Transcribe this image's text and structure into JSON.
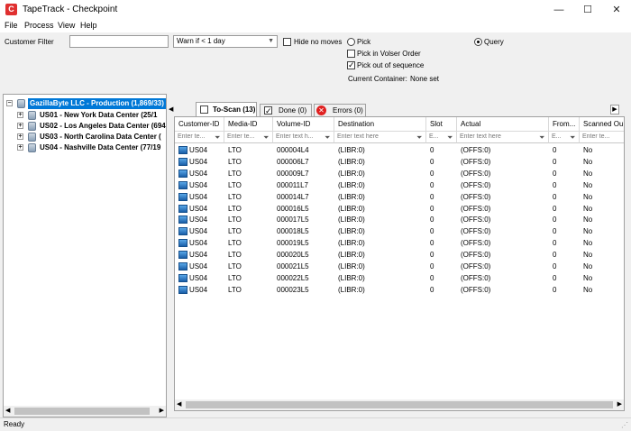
{
  "window": {
    "title": "TapeTrack - Checkpoint",
    "icon_letter": "C",
    "minimize": "—",
    "maximize": "☐",
    "close": "✕"
  },
  "menu": [
    "File",
    "Process",
    "View",
    "Help"
  ],
  "filter": {
    "customer_filter_label": "Customer Filter",
    "customer_filter_value": "",
    "warn_value": "Warn if < 1 day",
    "hide_no_moves": "Hide no moves",
    "pick": "Pick",
    "pick_volser_order": "Pick in Volser Order",
    "pick_out_of_sequence": "Pick out of sequence",
    "current_container_label": "Current Container:",
    "current_container_value": "None set",
    "query": "Query"
  },
  "tree": {
    "root": "GazillaByte LLC - Production (1,869/33)",
    "children": [
      "US01 - New York Data Center (25/1",
      "US02 - Los Angeles Data Center (694",
      "US03 - North Carolina Data Center (",
      "US04 - Nashville Data Center (77/19"
    ]
  },
  "tabs": [
    {
      "label": "To-Scan (13)",
      "icon": "checkbox-empty-icon"
    },
    {
      "label": "Done (0)",
      "icon": "checkbox-checked-icon"
    },
    {
      "label": "Errors (0)",
      "icon": "error-icon"
    }
  ],
  "grid": {
    "headers": [
      "Customer-ID",
      "Media-ID",
      "Volume-ID",
      "Destination",
      "Slot",
      "Actual",
      "From...",
      "Scanned Ou"
    ],
    "filters": [
      "Enter te...",
      "Enter te...",
      "Enter text h...",
      "Enter text here",
      "E...",
      "Enter text here",
      "E...",
      "Enter te..."
    ],
    "rows": [
      [
        "US04",
        "LTO",
        "000004L4",
        "(LIBR:0)",
        "0",
        "(OFFS:0)",
        "0",
        "No"
      ],
      [
        "US04",
        "LTO",
        "000006L7",
        "(LIBR:0)",
        "0",
        "(OFFS:0)",
        "0",
        "No"
      ],
      [
        "US04",
        "LTO",
        "000009L7",
        "(LIBR:0)",
        "0",
        "(OFFS:0)",
        "0",
        "No"
      ],
      [
        "US04",
        "LTO",
        "000011L7",
        "(LIBR:0)",
        "0",
        "(OFFS:0)",
        "0",
        "No"
      ],
      [
        "US04",
        "LTO",
        "000014L7",
        "(LIBR:0)",
        "0",
        "(OFFS:0)",
        "0",
        "No"
      ],
      [
        "US04",
        "LTO",
        "000016L5",
        "(LIBR:0)",
        "0",
        "(OFFS:0)",
        "0",
        "No"
      ],
      [
        "US04",
        "LTO",
        "000017L5",
        "(LIBR:0)",
        "0",
        "(OFFS:0)",
        "0",
        "No"
      ],
      [
        "US04",
        "LTO",
        "000018L5",
        "(LIBR:0)",
        "0",
        "(OFFS:0)",
        "0",
        "No"
      ],
      [
        "US04",
        "LTO",
        "000019L5",
        "(LIBR:0)",
        "0",
        "(OFFS:0)",
        "0",
        "No"
      ],
      [
        "US04",
        "LTO",
        "000020L5",
        "(LIBR:0)",
        "0",
        "(OFFS:0)",
        "0",
        "No"
      ],
      [
        "US04",
        "LTO",
        "000021L5",
        "(LIBR:0)",
        "0",
        "(OFFS:0)",
        "0",
        "No"
      ],
      [
        "US04",
        "LTO",
        "000022L5",
        "(LIBR:0)",
        "0",
        "(OFFS:0)",
        "0",
        "No"
      ],
      [
        "US04",
        "LTO",
        "000023L5",
        "(LIBR:0)",
        "0",
        "(OFFS:0)",
        "0",
        "No"
      ]
    ]
  },
  "status": "Ready"
}
